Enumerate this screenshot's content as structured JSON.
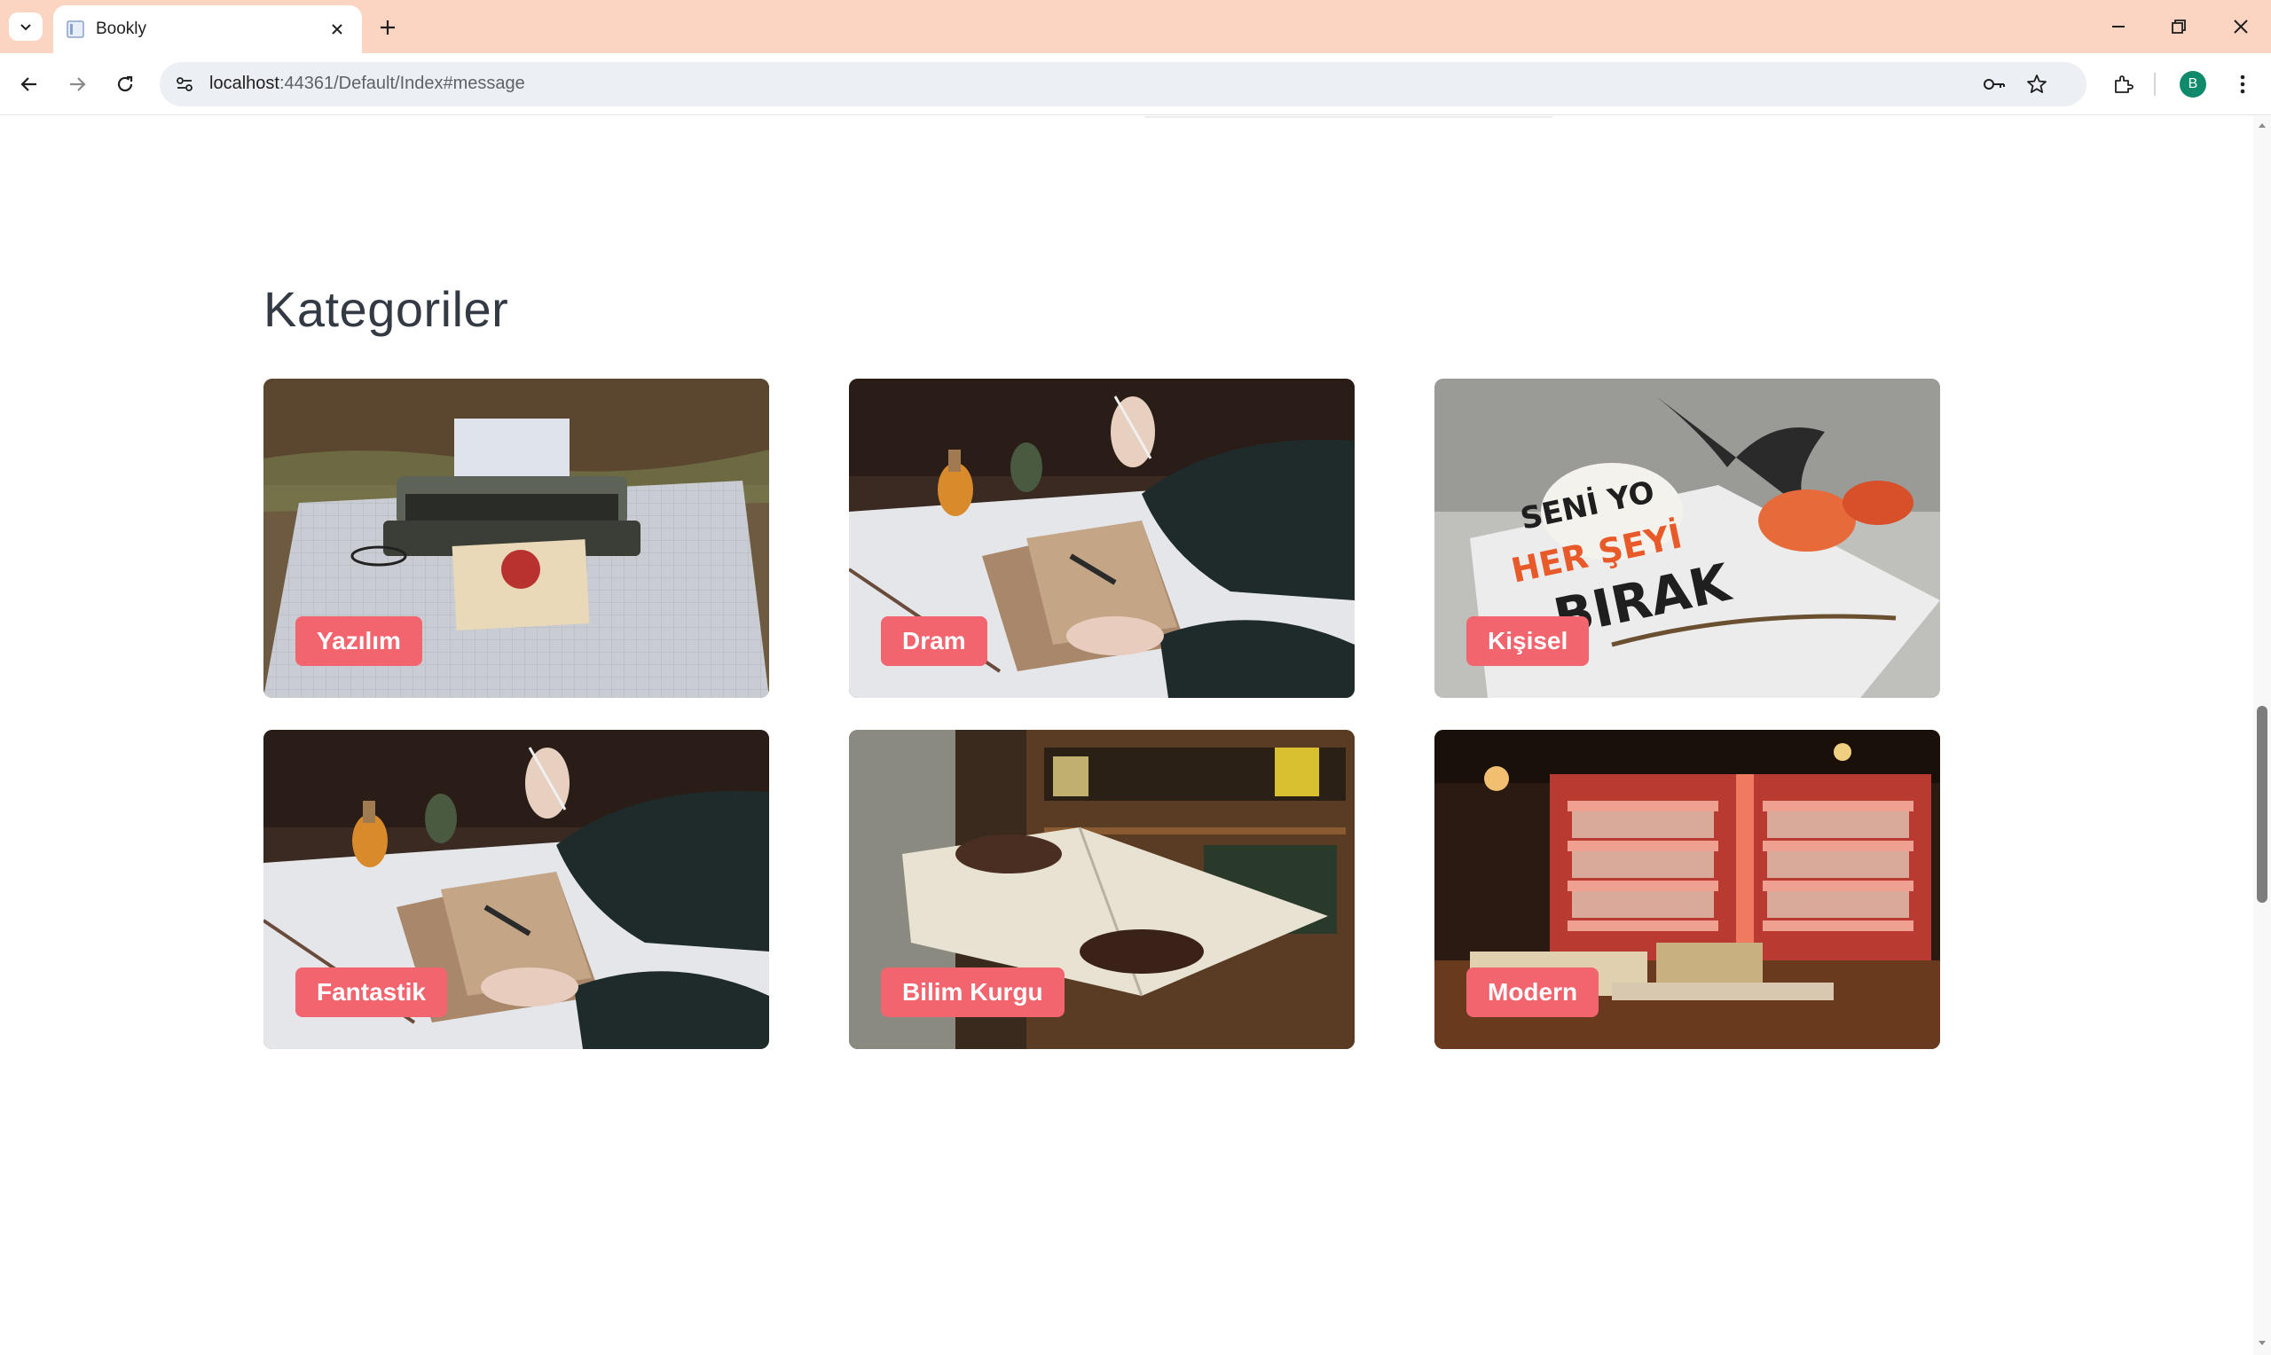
{
  "browser": {
    "tab_title": "Bookly",
    "url_host": "localhost",
    "url_rest": ":44361/Default/Index#message",
    "profile_initial": "B"
  },
  "page": {
    "section_title": "Kategoriler",
    "categories": [
      {
        "label": "Yazılım"
      },
      {
        "label": "Dram"
      },
      {
        "label": "Kişisel"
      },
      {
        "label": "Fantastik"
      },
      {
        "label": "Bilim Kurgu"
      },
      {
        "label": "Modern"
      }
    ]
  },
  "colors": {
    "tabstrip": "#fcd5c2",
    "label_bg": "#f2646e",
    "title_text": "#333a44"
  },
  "icons": [
    "tab-search-icon",
    "favicon-icon",
    "close-icon",
    "plus-icon",
    "minimize-icon",
    "restore-icon",
    "window-close-icon",
    "back-arrow-icon",
    "forward-arrow-icon",
    "reload-icon",
    "site-settings-icon",
    "password-key-icon",
    "bookmark-star-icon",
    "extensions-icon",
    "more-vert-icon"
  ]
}
